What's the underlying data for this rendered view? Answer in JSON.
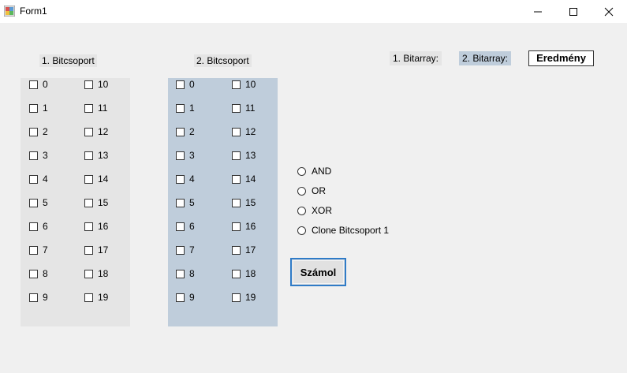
{
  "window": {
    "title": "Form1",
    "minimize_glyph": "—",
    "maximize_glyph": "☐",
    "close_glyph": "✕"
  },
  "group1": {
    "label": "1. Bitcsoport",
    "items": [
      "0",
      "1",
      "2",
      "3",
      "4",
      "5",
      "6",
      "7",
      "8",
      "9",
      "10",
      "11",
      "12",
      "13",
      "14",
      "15",
      "16",
      "17",
      "18",
      "19"
    ]
  },
  "group2": {
    "label": "2. Bitcsoport",
    "items": [
      "0",
      "1",
      "2",
      "3",
      "4",
      "5",
      "6",
      "7",
      "8",
      "9",
      "10",
      "11",
      "12",
      "13",
      "14",
      "15",
      "16",
      "17",
      "18",
      "19"
    ]
  },
  "operations": [
    "AND",
    "OR",
    "XOR",
    "Clone Bitcsoport 1"
  ],
  "labels": {
    "bitarray1": "1. Bitarray:",
    "bitarray2": "2. Bitarray:",
    "result": "Eredmény"
  },
  "button": {
    "calculate": "Számol"
  },
  "colors": {
    "panel1_bg": "#e5e5e5",
    "panel2_bg": "#bfcddb",
    "button_border": "#2f7bc7"
  }
}
